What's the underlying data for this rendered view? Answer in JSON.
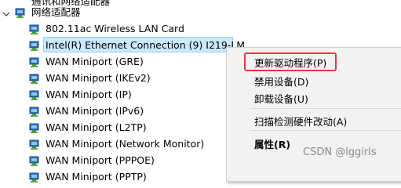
{
  "tree": {
    "clipped_top_label": "通讯和网络适配器",
    "category_label": "网络适配器",
    "devices": [
      "802.11ac Wireless LAN Card",
      "Intel(R) Ethernet Connection (9) I219-LM",
      "WAN Miniport (GRE)",
      "WAN Miniport (IKEv2)",
      "WAN Miniport (IP)",
      "WAN Miniport (IPv6)",
      "WAN Miniport (L2TP)",
      "WAN Miniport (Network Monitor)",
      "WAN Miniport (PPPOE)",
      "WAN Miniport (PPTP)"
    ],
    "selected_index": 1
  },
  "context_menu": {
    "items": [
      {
        "label": "更新驱动程序(P)",
        "highlighted": true
      },
      {
        "label": "禁用设备(D)"
      },
      {
        "label": "卸载设备(U)"
      },
      {
        "label": "扫描检测硬件改动(A)"
      },
      {
        "label": "属性(R)",
        "bold": true
      }
    ],
    "highlight_color": "#e03c3c"
  },
  "watermark": "CSDN @lggirls",
  "icons": {
    "category": "network-adapter-icon",
    "device": "network-adapter-icon",
    "expander": "chevron-down-icon"
  }
}
